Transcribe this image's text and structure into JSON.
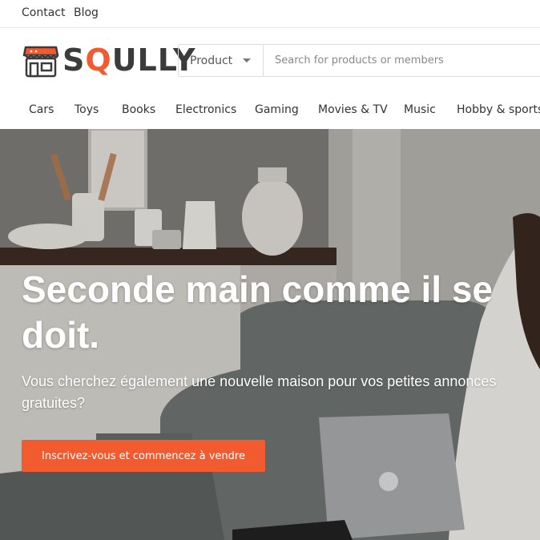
{
  "topbar": {
    "links": [
      {
        "label": "Contact"
      },
      {
        "label": "Blog"
      }
    ]
  },
  "header": {
    "logo": {
      "text_before": "S",
      "text_accent": "Q",
      "text_after": "ULLY",
      "accent_color": "#f25a30"
    },
    "search": {
      "scope_selected": "Product",
      "placeholder": "Search for products or members",
      "value": ""
    }
  },
  "categories": [
    {
      "label": "Cars"
    },
    {
      "label": "Toys"
    },
    {
      "label": "Books"
    },
    {
      "label": "Electronics"
    },
    {
      "label": "Gaming"
    },
    {
      "label": "Movies & TV"
    },
    {
      "label": "Music"
    },
    {
      "label": "Hobby & sports"
    }
  ],
  "hero": {
    "title": "Seconde main comme il se doit.",
    "subtitle": "Vous cherchez également une nouvelle maison pour vos petites annonces gratuites?",
    "cta_label": "Inscrivez-vous et commencez à vendre",
    "cta_color": "#f25a30"
  }
}
